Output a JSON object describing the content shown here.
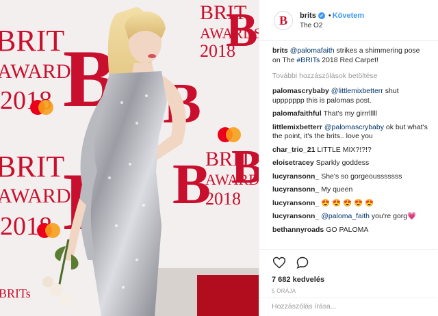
{
  "photo": {
    "wall_words": [
      "BRIT",
      "AWARDS",
      "2018",
      "BRIT",
      "AWARDS",
      "2018",
      "BRIT",
      "AWARDS",
      "2018",
      "BRIT",
      "AWARDS",
      "2018",
      "BRITs"
    ],
    "logo_letter": "B"
  },
  "header": {
    "username": "brits",
    "dot": "•",
    "follow_label": "Követem",
    "location": "The O2",
    "avatar_letter": "B"
  },
  "caption": {
    "user": "brits",
    "mention": "@palomafaith",
    "text1": " strikes a shimmering pose on The ",
    "hashtag": "#BRITs",
    "text2": " 2018 Red Carpet!"
  },
  "load_more": "További hozzászólások betöltése",
  "comments": [
    {
      "user": "palomascrybaby",
      "mention": "@littlemixbetterr",
      "text": " shut uppppppp this is palomas post."
    },
    {
      "user": "palomafaithful",
      "mention": "",
      "text": "That's my girrrlllll"
    },
    {
      "user": "littlemixbetterr",
      "mention": "@palomascrybaby",
      "text": " ok but what's the point, it's the brits.. love you"
    },
    {
      "user": "char_trio_21",
      "mention": "",
      "text": "LITTLE MIX?!?!?"
    },
    {
      "user": "eloisetracey",
      "mention": "",
      "text": "Sparkly goddess"
    },
    {
      "user": "lucyransonn_",
      "mention": "",
      "text": "She's so gorgeousssssss"
    },
    {
      "user": "lucyransonn_",
      "mention": "",
      "text": "My queen"
    },
    {
      "user": "lucyransonn_",
      "mention": "",
      "text": "😍 😍 😍 😍 😍"
    },
    {
      "user": "lucyransonn_",
      "mention": "@paloma_faith",
      "text": " you're gorg💗"
    },
    {
      "user": "bethannyroads",
      "mention": "",
      "text": "GO PALOMA"
    }
  ],
  "actions": {
    "likes": "7 682 kedvelés",
    "time": "5 ÓRÁJA",
    "comment_placeholder": "Hozzászólás írása..."
  },
  "colors": {
    "brand_red": "#c8102e",
    "link_blue": "#003569",
    "follow_blue": "#3897f0"
  },
  "icons": [
    "heart-icon",
    "comment-icon",
    "verified-badge-icon"
  ]
}
